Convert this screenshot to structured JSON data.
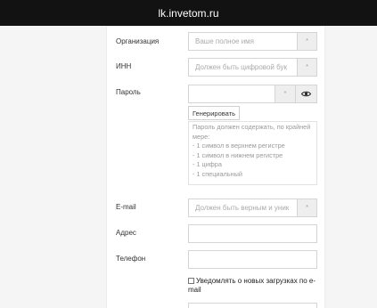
{
  "header": {
    "title": "lk.invetom.ru"
  },
  "form": {
    "organization": {
      "label": "Организация",
      "placeholder": "Ваше полное имя",
      "addon": "*"
    },
    "inn": {
      "label": "ИНН",
      "placeholder": "Должен быть цифровой бук",
      "addon": "*"
    },
    "password": {
      "label": "Пароль",
      "addon": "*",
      "toggle_icon": "eye-icon",
      "generate_label": "Генерировать",
      "hint_lines": [
        "Пароль должен содержать, по крайней",
        "мере:",
        "- 1 символ в верхнем регистре",
        "- 1 символ в нижнем регистре",
        "- 1 цифра",
        "- 1 специальный"
      ]
    },
    "email": {
      "label": "E-mail",
      "placeholder": "Должен быть верным и уник",
      "addon": "*"
    },
    "address": {
      "label": "Адрес",
      "value": ""
    },
    "phone": {
      "label": "Телефон",
      "value": ""
    },
    "notify": {
      "label": "Уведомлять о новых загрузках по e-mail",
      "checked": false
    }
  },
  "colors": {
    "topbar": "#121212",
    "background": "#f5f5f5",
    "card": "#ffffff",
    "border": "#d4d4d4"
  }
}
